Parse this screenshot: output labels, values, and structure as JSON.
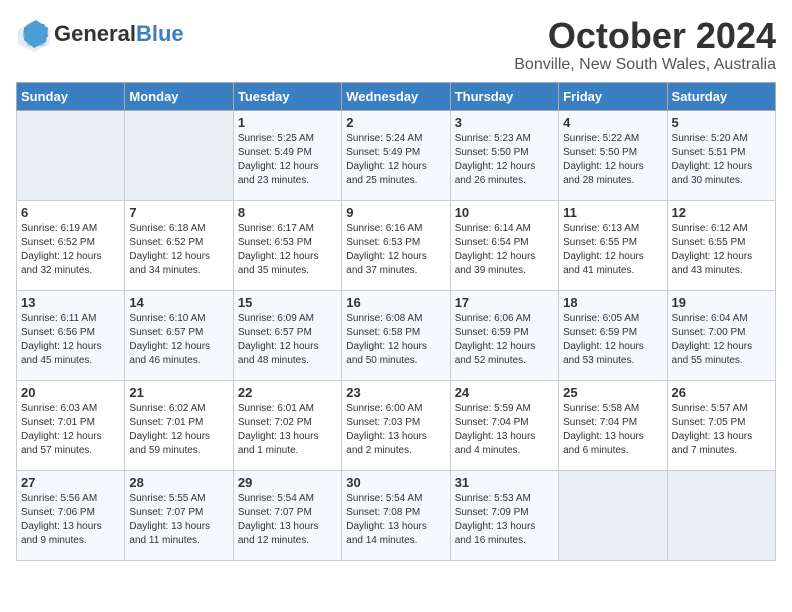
{
  "logo": {
    "general": "General",
    "blue": "Blue"
  },
  "header": {
    "month": "October 2024",
    "location": "Bonville, New South Wales, Australia"
  },
  "weekdays": [
    "Sunday",
    "Monday",
    "Tuesday",
    "Wednesday",
    "Thursday",
    "Friday",
    "Saturday"
  ],
  "weeks": [
    [
      {
        "day": "",
        "empty": true
      },
      {
        "day": "",
        "empty": true
      },
      {
        "day": "1",
        "sunrise": "5:25 AM",
        "sunset": "5:49 PM",
        "daylight": "12 hours and 23 minutes."
      },
      {
        "day": "2",
        "sunrise": "5:24 AM",
        "sunset": "5:49 PM",
        "daylight": "12 hours and 25 minutes."
      },
      {
        "day": "3",
        "sunrise": "5:23 AM",
        "sunset": "5:50 PM",
        "daylight": "12 hours and 26 minutes."
      },
      {
        "day": "4",
        "sunrise": "5:22 AM",
        "sunset": "5:50 PM",
        "daylight": "12 hours and 28 minutes."
      },
      {
        "day": "5",
        "sunrise": "5:20 AM",
        "sunset": "5:51 PM",
        "daylight": "12 hours and 30 minutes."
      }
    ],
    [
      {
        "day": "6",
        "sunrise": "6:19 AM",
        "sunset": "6:52 PM",
        "daylight": "12 hours and 32 minutes."
      },
      {
        "day": "7",
        "sunrise": "6:18 AM",
        "sunset": "6:52 PM",
        "daylight": "12 hours and 34 minutes."
      },
      {
        "day": "8",
        "sunrise": "6:17 AM",
        "sunset": "6:53 PM",
        "daylight": "12 hours and 35 minutes."
      },
      {
        "day": "9",
        "sunrise": "6:16 AM",
        "sunset": "6:53 PM",
        "daylight": "12 hours and 37 minutes."
      },
      {
        "day": "10",
        "sunrise": "6:14 AM",
        "sunset": "6:54 PM",
        "daylight": "12 hours and 39 minutes."
      },
      {
        "day": "11",
        "sunrise": "6:13 AM",
        "sunset": "6:55 PM",
        "daylight": "12 hours and 41 minutes."
      },
      {
        "day": "12",
        "sunrise": "6:12 AM",
        "sunset": "6:55 PM",
        "daylight": "12 hours and 43 minutes."
      }
    ],
    [
      {
        "day": "13",
        "sunrise": "6:11 AM",
        "sunset": "6:56 PM",
        "daylight": "12 hours and 45 minutes."
      },
      {
        "day": "14",
        "sunrise": "6:10 AM",
        "sunset": "6:57 PM",
        "daylight": "12 hours and 46 minutes."
      },
      {
        "day": "15",
        "sunrise": "6:09 AM",
        "sunset": "6:57 PM",
        "daylight": "12 hours and 48 minutes."
      },
      {
        "day": "16",
        "sunrise": "6:08 AM",
        "sunset": "6:58 PM",
        "daylight": "12 hours and 50 minutes."
      },
      {
        "day": "17",
        "sunrise": "6:06 AM",
        "sunset": "6:59 PM",
        "daylight": "12 hours and 52 minutes."
      },
      {
        "day": "18",
        "sunrise": "6:05 AM",
        "sunset": "6:59 PM",
        "daylight": "12 hours and 53 minutes."
      },
      {
        "day": "19",
        "sunrise": "6:04 AM",
        "sunset": "7:00 PM",
        "daylight": "12 hours and 55 minutes."
      }
    ],
    [
      {
        "day": "20",
        "sunrise": "6:03 AM",
        "sunset": "7:01 PM",
        "daylight": "12 hours and 57 minutes."
      },
      {
        "day": "21",
        "sunrise": "6:02 AM",
        "sunset": "7:01 PM",
        "daylight": "12 hours and 59 minutes."
      },
      {
        "day": "22",
        "sunrise": "6:01 AM",
        "sunset": "7:02 PM",
        "daylight": "13 hours and 1 minute."
      },
      {
        "day": "23",
        "sunrise": "6:00 AM",
        "sunset": "7:03 PM",
        "daylight": "13 hours and 2 minutes."
      },
      {
        "day": "24",
        "sunrise": "5:59 AM",
        "sunset": "7:04 PM",
        "daylight": "13 hours and 4 minutes."
      },
      {
        "day": "25",
        "sunrise": "5:58 AM",
        "sunset": "7:04 PM",
        "daylight": "13 hours and 6 minutes."
      },
      {
        "day": "26",
        "sunrise": "5:57 AM",
        "sunset": "7:05 PM",
        "daylight": "13 hours and 7 minutes."
      }
    ],
    [
      {
        "day": "27",
        "sunrise": "5:56 AM",
        "sunset": "7:06 PM",
        "daylight": "13 hours and 9 minutes."
      },
      {
        "day": "28",
        "sunrise": "5:55 AM",
        "sunset": "7:07 PM",
        "daylight": "13 hours and 11 minutes."
      },
      {
        "day": "29",
        "sunrise": "5:54 AM",
        "sunset": "7:07 PM",
        "daylight": "13 hours and 12 minutes."
      },
      {
        "day": "30",
        "sunrise": "5:54 AM",
        "sunset": "7:08 PM",
        "daylight": "13 hours and 14 minutes."
      },
      {
        "day": "31",
        "sunrise": "5:53 AM",
        "sunset": "7:09 PM",
        "daylight": "13 hours and 16 minutes."
      },
      {
        "day": "",
        "empty": true
      },
      {
        "day": "",
        "empty": true
      }
    ]
  ],
  "labels": {
    "sunrise": "Sunrise:",
    "sunset": "Sunset:",
    "daylight": "Daylight:"
  }
}
